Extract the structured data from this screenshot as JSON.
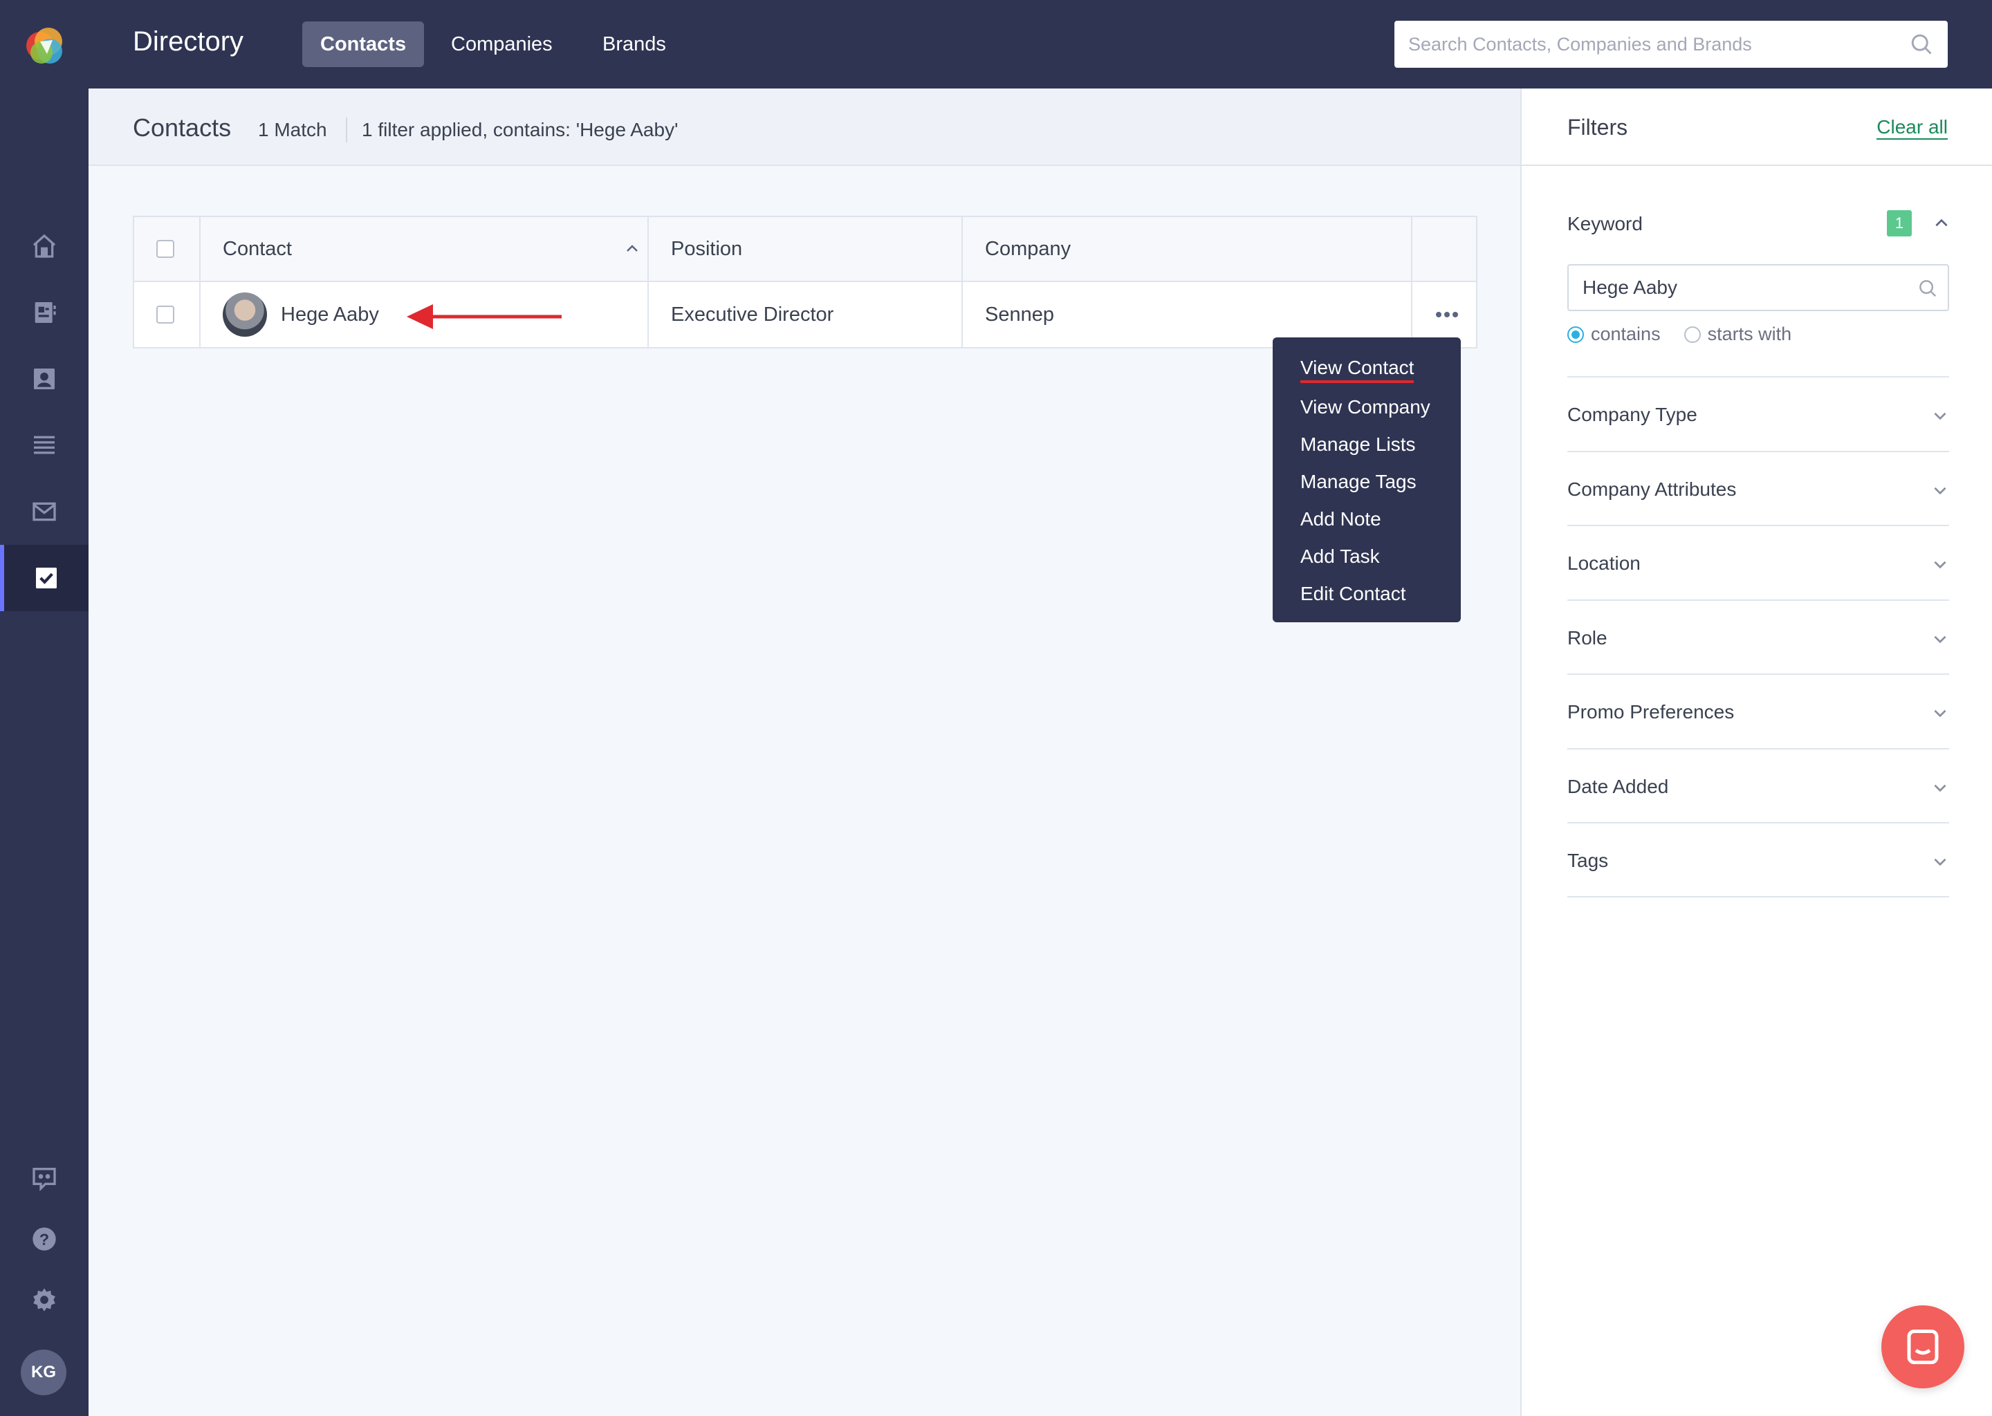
{
  "app": {
    "title": "Directory",
    "user_initials": "KG"
  },
  "top_tabs": [
    {
      "label": "Contacts",
      "active": true
    },
    {
      "label": "Companies",
      "active": false
    },
    {
      "label": "Brands",
      "active": false
    }
  ],
  "search": {
    "placeholder": "Search Contacts, Companies and Brands"
  },
  "sidebar_icons": [
    "home-icon",
    "address-book-icon",
    "contact-card-icon",
    "list-icon",
    "mail-icon",
    "tasks-icon",
    "feedback-icon",
    "help-icon",
    "settings-icon"
  ],
  "header": {
    "title": "Contacts",
    "count": "1 Match",
    "filter_summary": "1 filter applied, contains: 'Hege Aaby'"
  },
  "table": {
    "columns": [
      "Contact",
      "Position",
      "Company"
    ],
    "rows": [
      {
        "contact": "Hege Aaby",
        "position": "Executive Director",
        "company": "Sennep"
      }
    ]
  },
  "context_menu": {
    "items": [
      "View Contact",
      "View Company",
      "Manage Lists",
      "Manage Tags",
      "Add Note",
      "Add Task",
      "Edit Contact"
    ]
  },
  "filters": {
    "title": "Filters",
    "clear_all": "Clear all",
    "keyword": {
      "label": "Keyword",
      "badge": "1",
      "value": "Hege Aaby",
      "options": [
        "contains",
        "starts with"
      ],
      "selected": "contains"
    },
    "sections": [
      "Company Type",
      "Company Attributes",
      "Location",
      "Role",
      "Promo Preferences",
      "Date Added",
      "Tags"
    ]
  },
  "colors": {
    "nav_bg": "#2f3452",
    "accent_green": "#1b8a5a",
    "badge_green": "#5bc98e",
    "radio_blue": "#2bb0e0",
    "annotation_red": "#e0282e",
    "chat_bubble": "#f25f5c"
  }
}
